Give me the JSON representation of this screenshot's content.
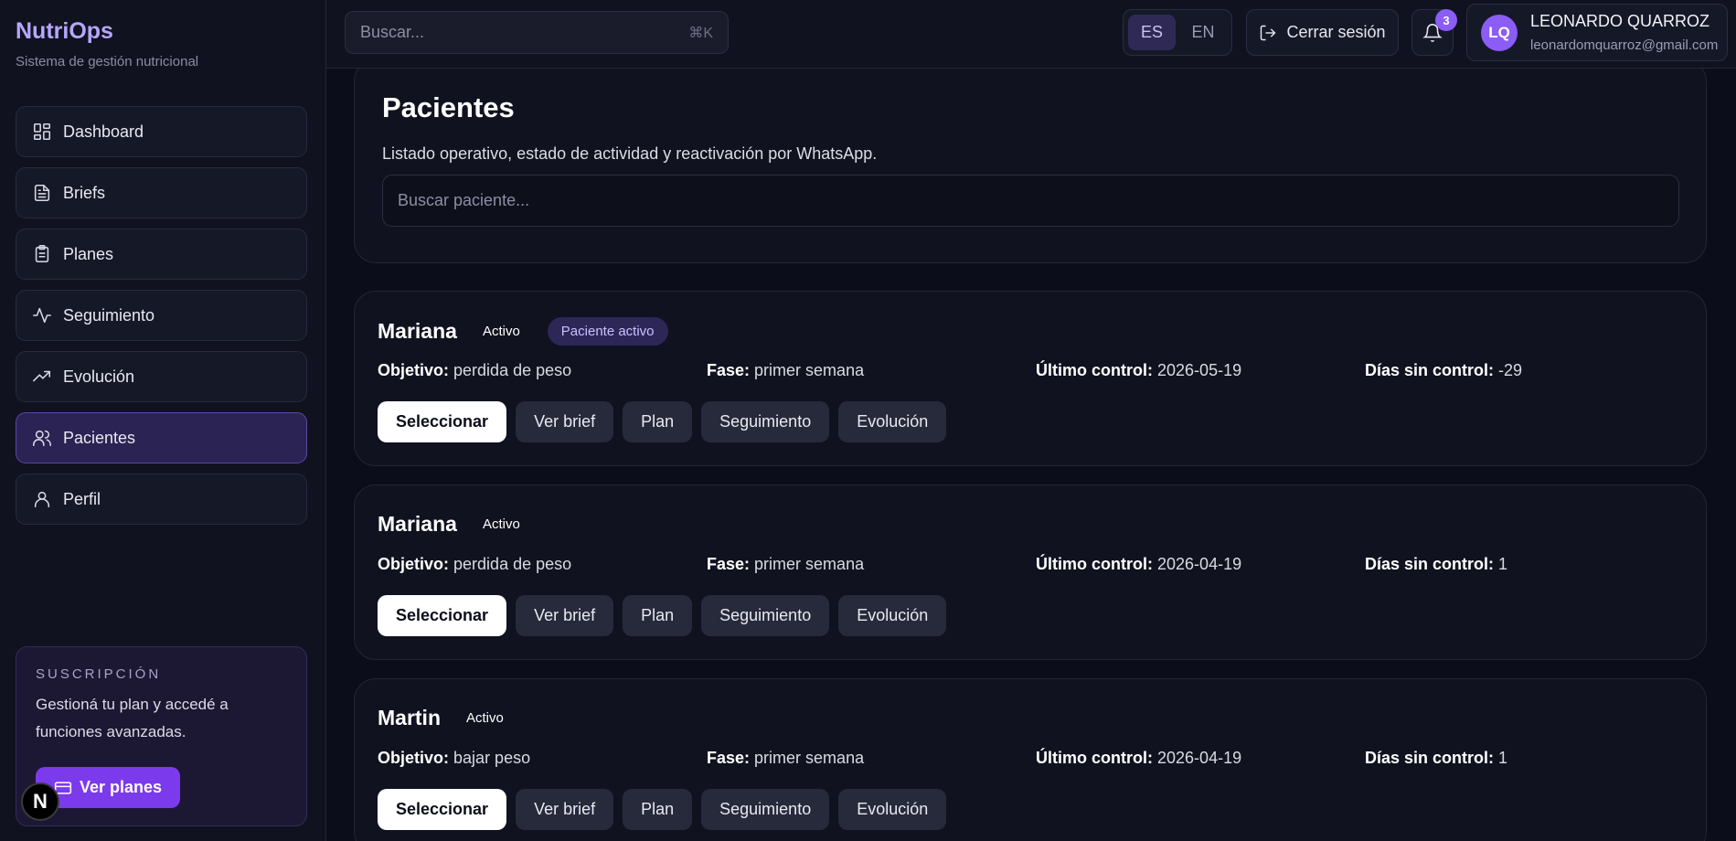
{
  "brand": {
    "title": "NutriOps",
    "subtitle": "Sistema de gestión nutricional"
  },
  "sidebar": {
    "items": [
      {
        "label": "Dashboard",
        "icon": "grid-icon"
      },
      {
        "label": "Briefs",
        "icon": "document-icon"
      },
      {
        "label": "Planes",
        "icon": "clipboard-icon"
      },
      {
        "label": "Seguimiento",
        "icon": "activity-icon"
      },
      {
        "label": "Evolución",
        "icon": "trending-up-icon"
      },
      {
        "label": "Pacientes",
        "icon": "users-icon",
        "active": true
      },
      {
        "label": "Perfil",
        "icon": "user-icon"
      }
    ]
  },
  "subscription": {
    "kicker": "SUSCRIPCIÓN",
    "text": "Gestioná tu plan y accedé a funciones avanzadas.",
    "button": "Ver planes"
  },
  "topbar": {
    "search_placeholder": "Buscar...",
    "search_shortcut": "⌘K",
    "lang": [
      "ES",
      "EN"
    ],
    "lang_active": "ES",
    "logout": "Cerrar sesión",
    "notifications_count": "3",
    "user": {
      "initials": "LQ",
      "name": "LEONARDO QUARROZ",
      "email": "leonardomquarroz@gmail.com"
    }
  },
  "page": {
    "title": "Pacientes",
    "subtitle": "Listado operativo, estado de actividad y reactivación por WhatsApp.",
    "search_placeholder": "Buscar paciente..."
  },
  "labels": {
    "objective": "Objetivo:",
    "phase": "Fase:",
    "last_control": "Último control:",
    "days_without": "Días sin control:",
    "actions": [
      "Seleccionar",
      "Ver brief",
      "Plan",
      "Seguimiento",
      "Evolución"
    ]
  },
  "patients": [
    {
      "name": "Mariana",
      "status": "Activo",
      "badge": "Paciente activo",
      "objective": "perdida de peso",
      "phase": "primer semana",
      "last_control": "2026-05-19",
      "days_without": "-29"
    },
    {
      "name": "Mariana",
      "status": "Activo",
      "badge": "",
      "objective": "perdida de peso",
      "phase": "primer semana",
      "last_control": "2026-04-19",
      "days_without": "1"
    },
    {
      "name": "Martin",
      "status": "Activo",
      "badge": "",
      "objective": "bajar peso",
      "phase": "primer semana",
      "last_control": "2026-04-19",
      "days_without": "1"
    }
  ],
  "colors": {
    "accent": "#7c3aed",
    "accent_light": "#b7a6ff",
    "background": "#0b0d1a",
    "panel": "#10121f"
  }
}
